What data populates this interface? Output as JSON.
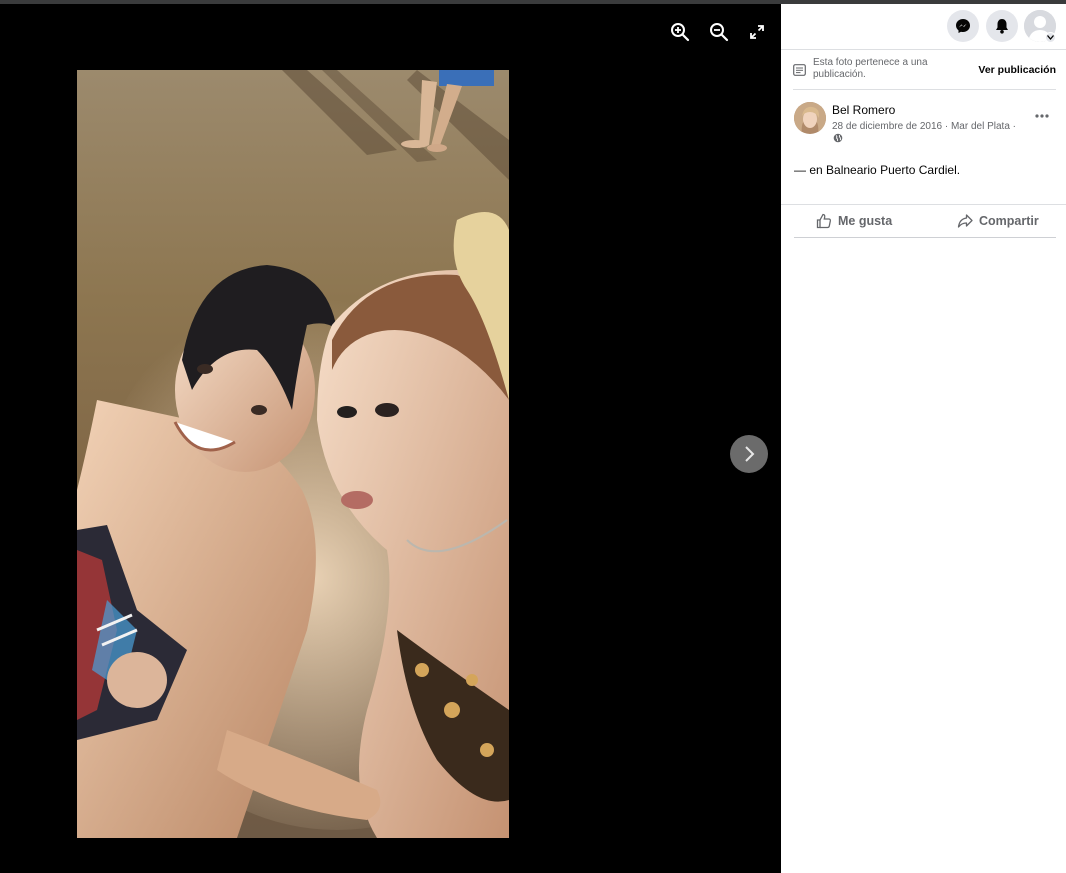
{
  "viewer": {
    "zoom_in_icon": "zoom-in-icon",
    "zoom_out_icon": "zoom-out-icon",
    "fullscreen_icon": "fullscreen-icon",
    "next_icon": "chevron-right-icon"
  },
  "topbar": {
    "messenger_icon": "messenger-icon",
    "notifications_icon": "bell-icon",
    "account_icon": "avatar"
  },
  "notice": {
    "text": "Esta foto pertenece a una publicación.",
    "link": "Ver publicación"
  },
  "post": {
    "author": "Bel Romero",
    "meta": "28 de diciembre de 2016 · Mar del Plata ·",
    "privacy_icon": "globe-icon",
    "caption_prefix": "— en",
    "caption_place": "Balneario Puerto Cardiel",
    "caption_suffix": "."
  },
  "actions": {
    "like": "Me gusta",
    "share": "Compartir"
  },
  "colors": {
    "panel_bg": "#ffffff",
    "viewer_bg": "#000000",
    "secondary_text": "#65676b",
    "button_bg": "#e4e6eb"
  }
}
